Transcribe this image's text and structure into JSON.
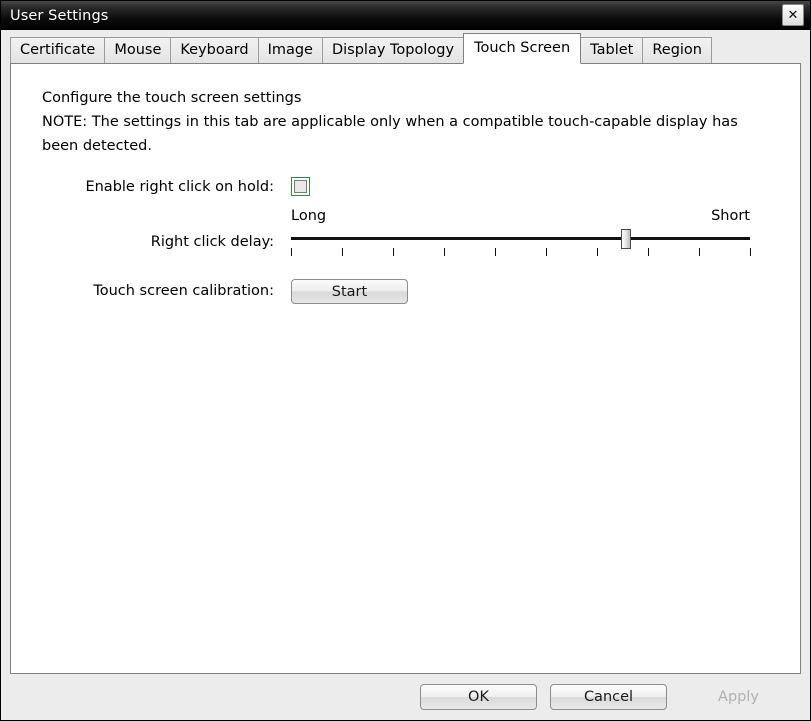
{
  "window": {
    "title": "User Settings",
    "close_icon": "close-icon",
    "close_glyph": "✕"
  },
  "tabs": [
    {
      "label": "Certificate",
      "active": false
    },
    {
      "label": "Mouse",
      "active": false
    },
    {
      "label": "Keyboard",
      "active": false
    },
    {
      "label": "Image",
      "active": false
    },
    {
      "label": "Display Topology",
      "active": false
    },
    {
      "label": "Touch Screen",
      "active": true
    },
    {
      "label": "Tablet",
      "active": false
    },
    {
      "label": "Region",
      "active": false
    }
  ],
  "panel": {
    "intro_line1": "Configure the touch screen settings",
    "intro_line2": "NOTE: The settings in this tab are applicable only when a compatible touch-capable display has been detected.",
    "rows": {
      "right_click_hold": {
        "label": "Enable right click on hold:",
        "checked": false,
        "focused": true
      },
      "right_click_delay": {
        "label": "Right click delay:",
        "min_label": "Long",
        "max_label": "Short",
        "tick_count": 10,
        "value_percent": 73
      },
      "calibration": {
        "label": "Touch screen calibration:",
        "button_label": "Start"
      }
    }
  },
  "footer": {
    "ok_label": "OK",
    "cancel_label": "Cancel",
    "apply_label": "Apply",
    "apply_enabled": false
  },
  "colors": {
    "focus_green": "#2e8b3d",
    "panel_bg": "#ffffff",
    "dialog_bg": "#ececec",
    "border_gray": "#808080",
    "title_text": "#ffffff"
  }
}
